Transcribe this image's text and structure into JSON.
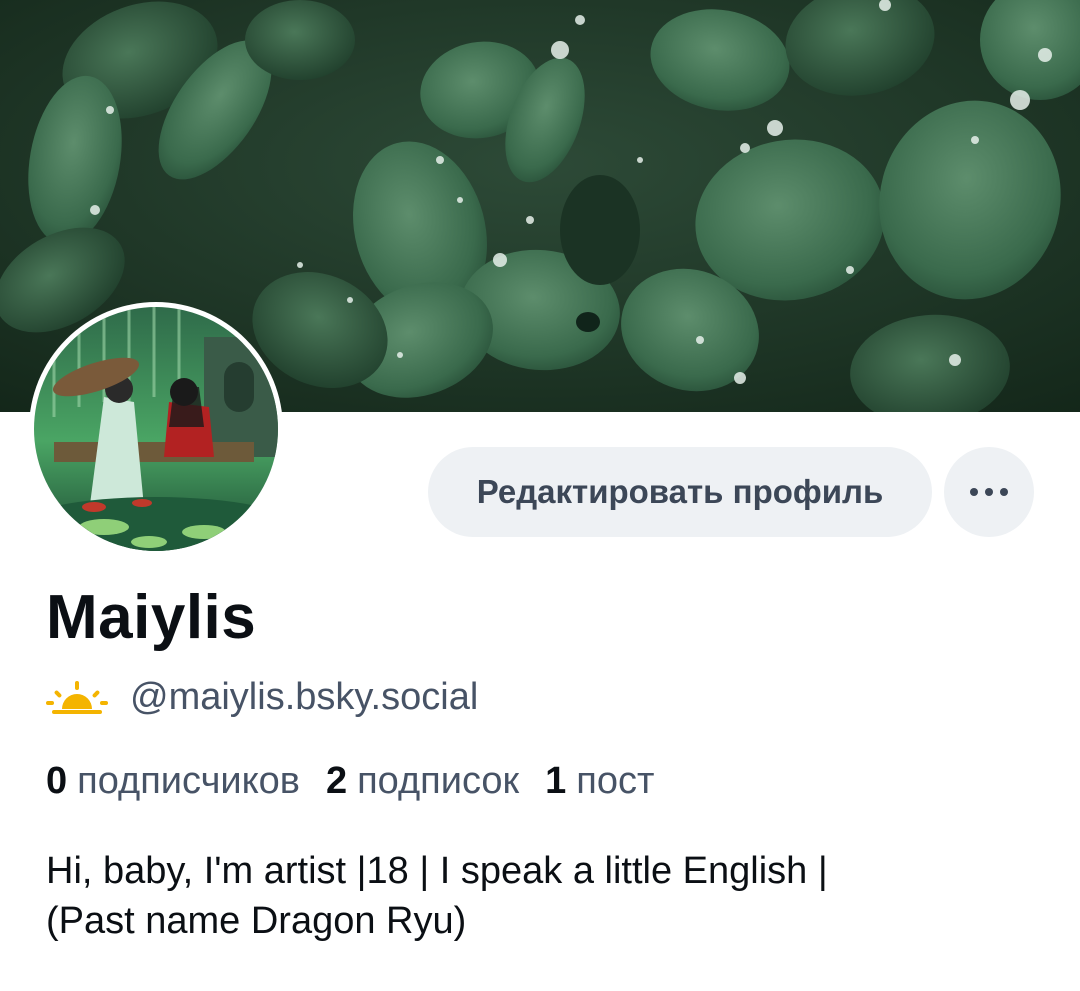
{
  "profile": {
    "display_name": "Maiylis",
    "handle": "@maiylis.bsky.social",
    "bio_line1": "Hi, baby, I'm artist |18 | I speak a little English |",
    "bio_line2": "(Past name Dragon Ryu)"
  },
  "actions": {
    "edit_profile_label": "Редактировать профиль",
    "more_label": "···"
  },
  "stats": {
    "followers_count": "0",
    "followers_label": "подписчиков",
    "following_count": "2",
    "following_label": "подписок",
    "posts_count": "1",
    "posts_label": "пост"
  },
  "icons": {
    "handle_icon": "sunrise-icon",
    "more_icon": "ellipsis-icon"
  },
  "colors": {
    "button_bg": "#eef1f4",
    "button_text": "#3c4757",
    "muted_text": "#475366",
    "primary_text": "#0b0f14",
    "banner_green": "#2f5a40"
  }
}
